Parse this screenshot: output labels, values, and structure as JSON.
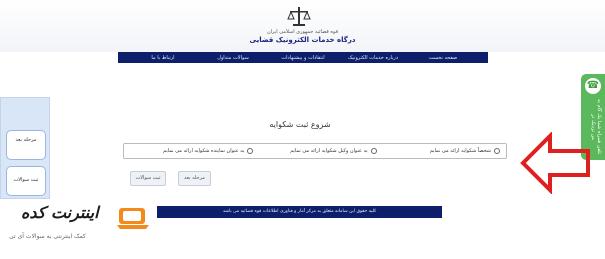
{
  "header": {
    "org_line": "قوه قضائیه جمهوری اسلامی ایران",
    "title": "درگاه خدمات الکترونیک قضایی"
  },
  "nav": {
    "items": [
      "صفحه نخست",
      "درباره خدمات الکترونیک",
      "انتقادات و پیشنهادات",
      "سوالات متداول",
      "ارتباط با ما"
    ]
  },
  "side_tab": {
    "label": "تلفن همراه شما یک گام به من نزدیک تر"
  },
  "left_panel": {
    "step1": "مرحله بعد",
    "step2": "ثبت سوالات"
  },
  "form": {
    "title": "شروع ثبت شکوایه",
    "options": [
      {
        "label": "شخصاً شکوایه ارائه می نمایم",
        "selected": false
      },
      {
        "label": "به عنوان وکیل شکوایه ارائه می نمایم",
        "selected": false
      },
      {
        "label": "به عنوان نماینده شکوایه ارائه می نمایم",
        "selected": false
      }
    ],
    "next_button": "مرحله بعد",
    "submit_button": "ثبت سوالات"
  },
  "footer": {
    "text": "کلیه حقوق این سامانه متعلق به مرکز آمار و فناوری اطلاعات قوه قضائیه می باشد"
  },
  "watermark": {
    "brand": "اینترنت کده",
    "tagline": "کمک اینترنتی به سوالات آی تی"
  },
  "colors": {
    "nav_bg": "#0d1f6b",
    "arrow": "#e01f1f",
    "side_tab": "#5cb85c",
    "panel_bg": "#d9e6f7",
    "brand_accent": "#f28a1e"
  }
}
